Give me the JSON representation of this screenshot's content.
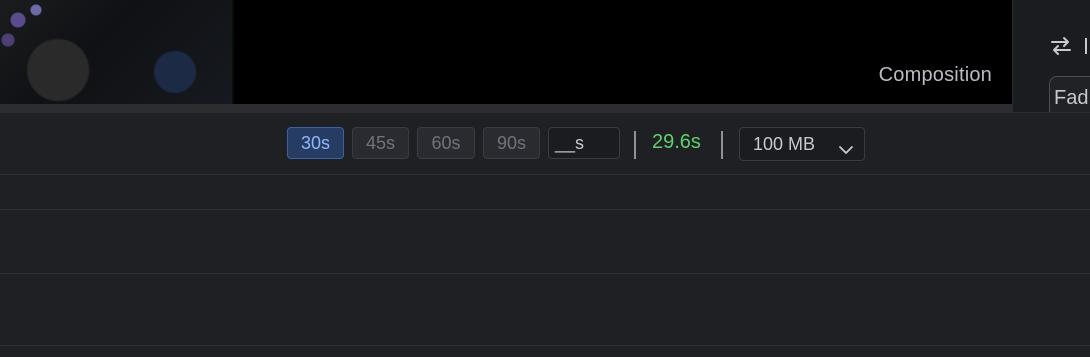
{
  "preview": {
    "composition_label": "Composition"
  },
  "side_panel": {
    "swap_icon": "swap-arrows-icon",
    "card_text": "Fad"
  },
  "toolbar": {
    "duration_options": [
      {
        "label": "30s",
        "active": true
      },
      {
        "label": "45s",
        "active": false
      },
      {
        "label": "60s",
        "active": false
      },
      {
        "label": "90s",
        "active": false
      }
    ],
    "custom_input_value": "__s",
    "current_duration": "29.6s",
    "size_select_value": "100 MB",
    "colors": {
      "active_bg": "#263c62",
      "active_text": "#8fb7ff",
      "duration_text": "#5fcf6e"
    }
  }
}
